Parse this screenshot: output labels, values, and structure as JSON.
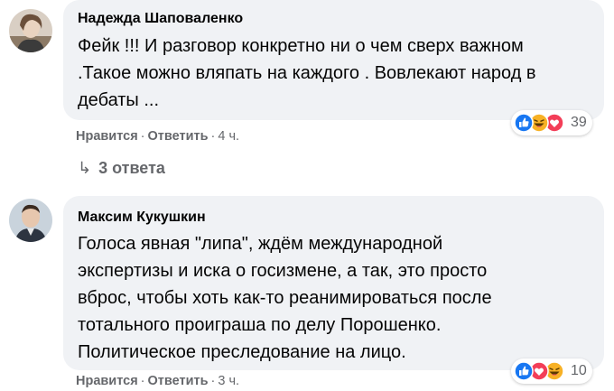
{
  "comments": [
    {
      "author": "Надежда Шаповаленко",
      "lines": [
        "Фейк !!! И разговор конкретно ни о чем сверх важном",
        ".Такое можно вляпать на каждого . Вовлекают народ в",
        "дебаты ..."
      ],
      "like_label": "Нравится",
      "reply_label": "Ответить",
      "time": "4 ч.",
      "reactions": [
        "like-icon",
        "haha-icon",
        "love-icon"
      ],
      "reaction_count": "39"
    },
    {
      "author": "Максим Кукушкин",
      "lines": [
        "Голоса явная \"липа\", ждём международной",
        "экспертизы и иска о госизмене, а так, это просто",
        "вброс, чтобы хоть как-то реанимироваться после",
        "тотального проиграша по делу Порошенко.",
        "Политическое преследование на лицо."
      ],
      "like_label": "Нравится",
      "reply_label": "Ответить",
      "time": "3 ч.",
      "reactions": [
        "like-icon",
        "love-icon",
        "haha-icon"
      ],
      "reaction_count": "10"
    }
  ],
  "replies_label": "3 ответа",
  "dot_separator": "·",
  "colors": {
    "bubble": "#f0f2f5",
    "secondary_text": "#65676b",
    "like_blue": "#1877f2",
    "love_red": "#f33e58",
    "haha_yellow": "#f7b125"
  }
}
